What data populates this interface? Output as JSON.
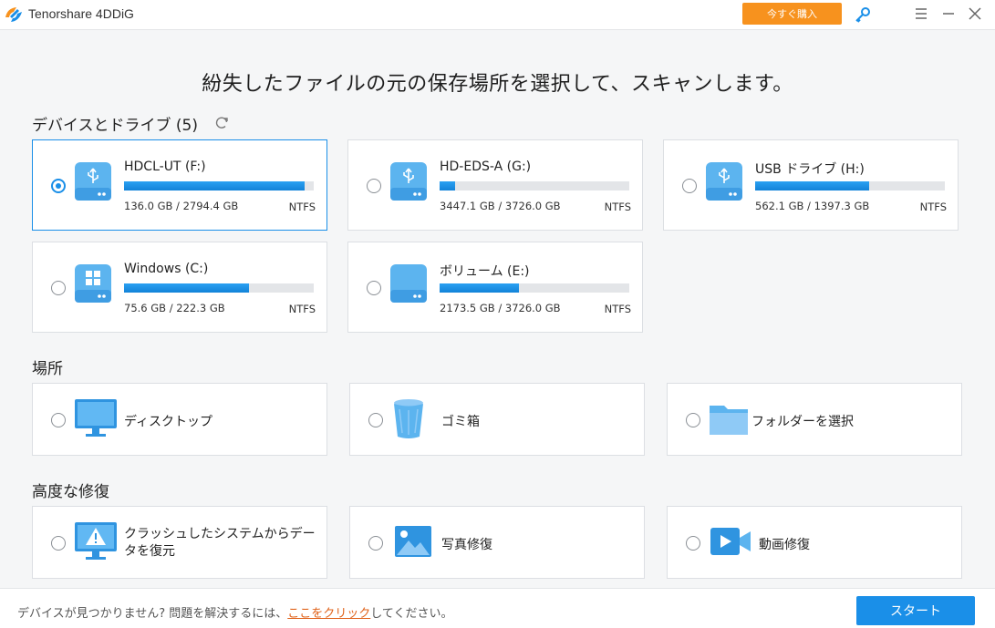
{
  "app": {
    "title": "Tenorshare 4DDiG",
    "buy_label": "今すぐ購入"
  },
  "heading": "紛失したファイルの元の保存場所を選択して、スキャンします。",
  "devices": {
    "section_title": "デバイスとドライブ (5)",
    "items": [
      {
        "name": "HDCL-UT (F:)",
        "size": "136.0 GB / 2794.4 GB",
        "fs": "NTFS",
        "usage": 0.95,
        "type": "usb",
        "selected": true
      },
      {
        "name": "HD-EDS-A (G:)",
        "size": "3447.1 GB / 3726.0 GB",
        "fs": "NTFS",
        "usage": 0.08,
        "type": "usb",
        "selected": false
      },
      {
        "name": "USB ドライブ (H:)",
        "size": "562.1 GB / 1397.3 GB",
        "fs": "NTFS",
        "usage": 0.6,
        "type": "usb",
        "selected": false
      },
      {
        "name": "Windows (C:)",
        "size": "75.6 GB / 222.3 GB",
        "fs": "NTFS",
        "usage": 0.66,
        "type": "windows",
        "selected": false
      },
      {
        "name": "ボリューム (E:)",
        "size": "2173.5 GB / 3726.0 GB",
        "fs": "NTFS",
        "usage": 0.42,
        "type": "disk",
        "selected": false
      }
    ]
  },
  "locations": {
    "section_title": "場所",
    "items": [
      {
        "label": "ディスクトップ",
        "icon": "desktop-icon"
      },
      {
        "label": "ゴミ箱",
        "icon": "recycle-bin-icon"
      },
      {
        "label": "フォルダーを選択",
        "icon": "folder-icon"
      }
    ]
  },
  "advanced": {
    "section_title": "高度な修復",
    "items": [
      {
        "label_line1": "クラッシュしたシステムからデー",
        "label_line2": "タを復元",
        "icon": "crashed-system-icon"
      },
      {
        "label": "写真修復",
        "icon": "photo-icon"
      },
      {
        "label": "動画修復",
        "icon": "video-icon"
      }
    ]
  },
  "footer": {
    "text_before": "デバイスが見つかりません? 問題を解決するには、",
    "link": "ここをクリック",
    "text_after": "してください。",
    "start_label": "スタート"
  },
  "colors": {
    "accent": "#1a8fe8",
    "buy": "#f7921e",
    "link": "#e0621a"
  }
}
